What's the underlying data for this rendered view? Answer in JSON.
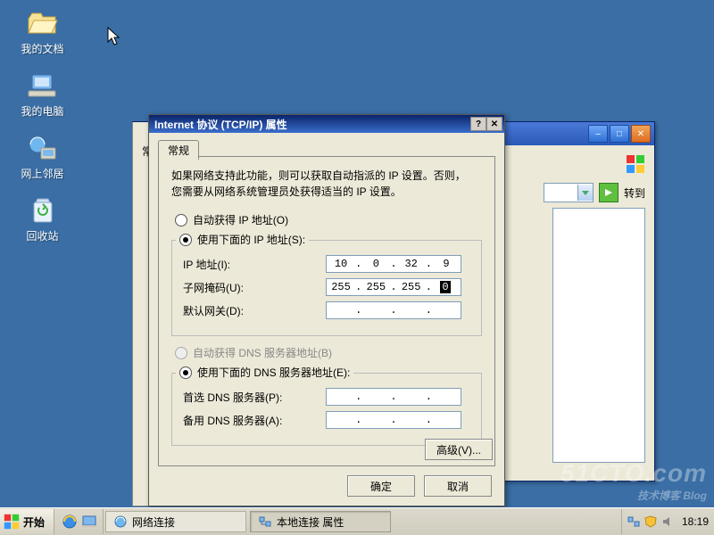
{
  "desktop_icons": {
    "docs": "我的文档",
    "computer": "我的电脑",
    "network": "网上邻居",
    "recycle": "回收站"
  },
  "explorer": {
    "go_label": "转到"
  },
  "tcpip": {
    "title": "Internet 协议 (TCP/IP) 属性",
    "tab": "常规",
    "hint_l1": "如果网络支持此功能，则可以获取自动指派的 IP 设置。否则，",
    "hint_l2": "您需要从网络系统管理员处获得适当的 IP 设置。",
    "auto_ip": "自动获得 IP 地址(O)",
    "use_ip": "使用下面的 IP 地址(S):",
    "ip_label": "IP 地址(I):",
    "mask_label": "子网掩码(U):",
    "gw_label": "默认网关(D):",
    "auto_dns": "自动获得 DNS 服务器地址(B)",
    "use_dns": "使用下面的 DNS 服务器地址(E):",
    "pref_dns": "首选 DNS 服务器(P):",
    "alt_dns": "备用 DNS 服务器(A):",
    "advanced": "高级(V)...",
    "ok": "确定",
    "cancel": "取消",
    "ip": {
      "a": "10",
      "b": "0",
      "c": "32",
      "d": "9"
    },
    "mask": {
      "a": "255",
      "b": "255",
      "c": "255",
      "d": "0"
    }
  },
  "taskbar": {
    "start": "开始",
    "task1": "网络连接",
    "task2": "本地连接 属性",
    "time": "18:19"
  },
  "watermark": {
    "main": "51CTO.com",
    "sub": "技术博客   Blog"
  }
}
